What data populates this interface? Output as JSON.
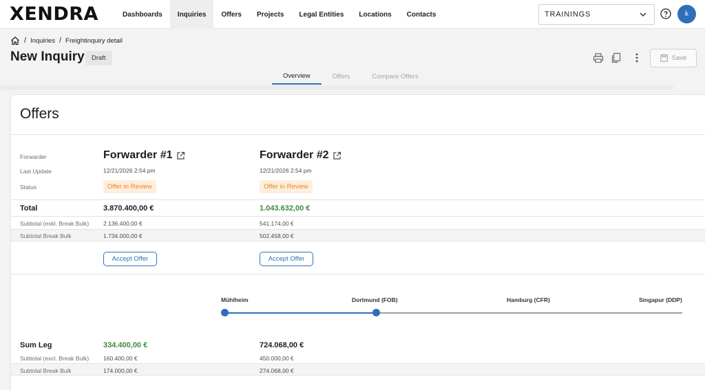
{
  "app": {
    "logo": "XENDRA",
    "nav": [
      "Dashboards",
      "Inquiries",
      "Offers",
      "Projects",
      "Legal Entities",
      "Locations",
      "Contacts"
    ],
    "active_nav": "Inquiries",
    "workspace_select": "TRAININGS",
    "avatar_initial": "k"
  },
  "breadcrumb": {
    "items": [
      "Inquiries",
      "Freightinquiry detail"
    ]
  },
  "header": {
    "title": "New Inquiry",
    "badge": "Draft",
    "save_label": "Save"
  },
  "tabs": {
    "items": [
      "Overview",
      "Offers",
      "Compare Offers"
    ],
    "active": "Overview"
  },
  "offers": {
    "title": "Offers",
    "labels": {
      "forwarder": "Forwarder",
      "last_update": "Last Update",
      "status": "Status",
      "total": "Total",
      "subtotal_excl": "Subtotal (exkl. Break Bulk)",
      "subtotal_bb": "Subtotal Break Bulk"
    },
    "forwarders": [
      {
        "name": "Forwarder #1",
        "last_update": "12/21/2026 2:54 pm",
        "status": "Offer in Review",
        "total": "3.870.400,00 €",
        "subtotal_excl": "2.136.400,00 €",
        "subtotal_bb": "1.734.000,00 €",
        "accept_label": "Accept Offer",
        "total_color": "#1c1c1c"
      },
      {
        "name": "Forwarder #2",
        "last_update": "12/21/2026 2:54 pm",
        "status": "Offer in Review",
        "total": "1.043.632,00 €",
        "subtotal_excl": "541.174,00 €",
        "subtotal_bb": "502.458,00 €",
        "accept_label": "Accept Offer",
        "total_color": "#3c8a3c"
      }
    ]
  },
  "route": {
    "stops": [
      "Mühlheim",
      "Dortmund (FOB)",
      "Hamburg (CFR)",
      "Singapur (DDP)"
    ],
    "active_color": "#2f6fb9",
    "inactive_color": "#9e9e9e"
  },
  "legs": {
    "labels": {
      "sum": "Sum Leg",
      "subtotal_excl": "Subtotal (excl. Break Bulk)",
      "subtotal_bb": "Subtotal Break Bulk"
    },
    "values": [
      {
        "sum": "334.400,00 €",
        "subtotal_excl": "160.400,00 €",
        "subtotal_bb": "174.000,00 €"
      },
      {
        "sum": "724.068,00 €",
        "subtotal_excl": "450.000,00 €",
        "subtotal_bb": "274.068,00 €"
      }
    ]
  },
  "colors": {
    "accent": "#2f6fb9",
    "status_orange": "#e8891c",
    "status_bg": "#fdeedd",
    "positive_green": "#3c8a3c"
  }
}
